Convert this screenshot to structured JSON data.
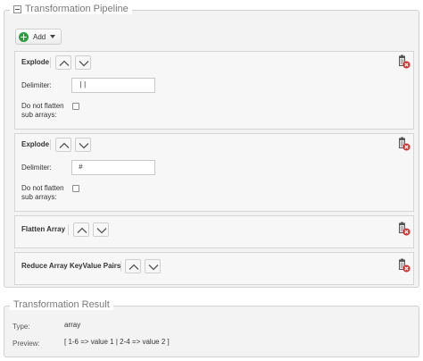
{
  "pipeline": {
    "title": "Transformation Pipeline",
    "add_label": "Add",
    "steps": [
      {
        "title": "Explode",
        "delimiter_label": "Delimiter:",
        "delimiter_value": "||",
        "flatten_label_line1": "Do not flatten",
        "flatten_label_line2": "sub arrays:"
      },
      {
        "title": "Explode",
        "delimiter_label": "Delimiter:",
        "delimiter_value": "#",
        "flatten_label_line1": "Do not flatten",
        "flatten_label_line2": "sub arrays:"
      },
      {
        "title": "Flatten Array"
      },
      {
        "title": "Reduce Array KeyValue Pairs"
      }
    ]
  },
  "result": {
    "title": "Transformation Result",
    "type_label": "Type:",
    "type_value": "array",
    "preview_label": "Preview:",
    "preview_value": "[ 1-6 => value 1 | 2-4 => value 2 ]"
  },
  "colors": {
    "add_icon": "#27a23a",
    "delete_icon_badge": "#d9302c"
  },
  "icons": [
    "collapse-icon",
    "plus-icon",
    "caret-down-icon",
    "chevron-up-icon",
    "chevron-down-icon",
    "trash-delete-icon"
  ]
}
